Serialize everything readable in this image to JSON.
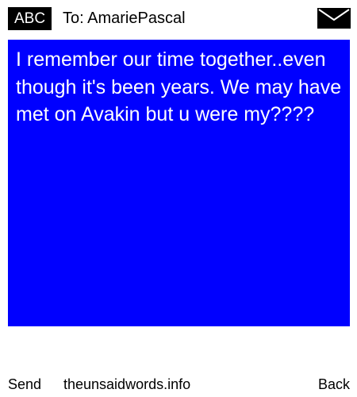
{
  "header": {
    "input_mode": "ABC",
    "recipient": "To: AmariePascal",
    "envelope_icon": "envelope-icon"
  },
  "message": {
    "text": "I remember our time together..even though it's been years. We may have met on Avakin but u were my????"
  },
  "footer": {
    "send_label": "Send",
    "site_label": "theunsaidwords.info",
    "back_label": "Back"
  },
  "colors": {
    "message_background": "#0000ff",
    "message_text": "#ffffff",
    "header_badge_background": "#000000"
  }
}
